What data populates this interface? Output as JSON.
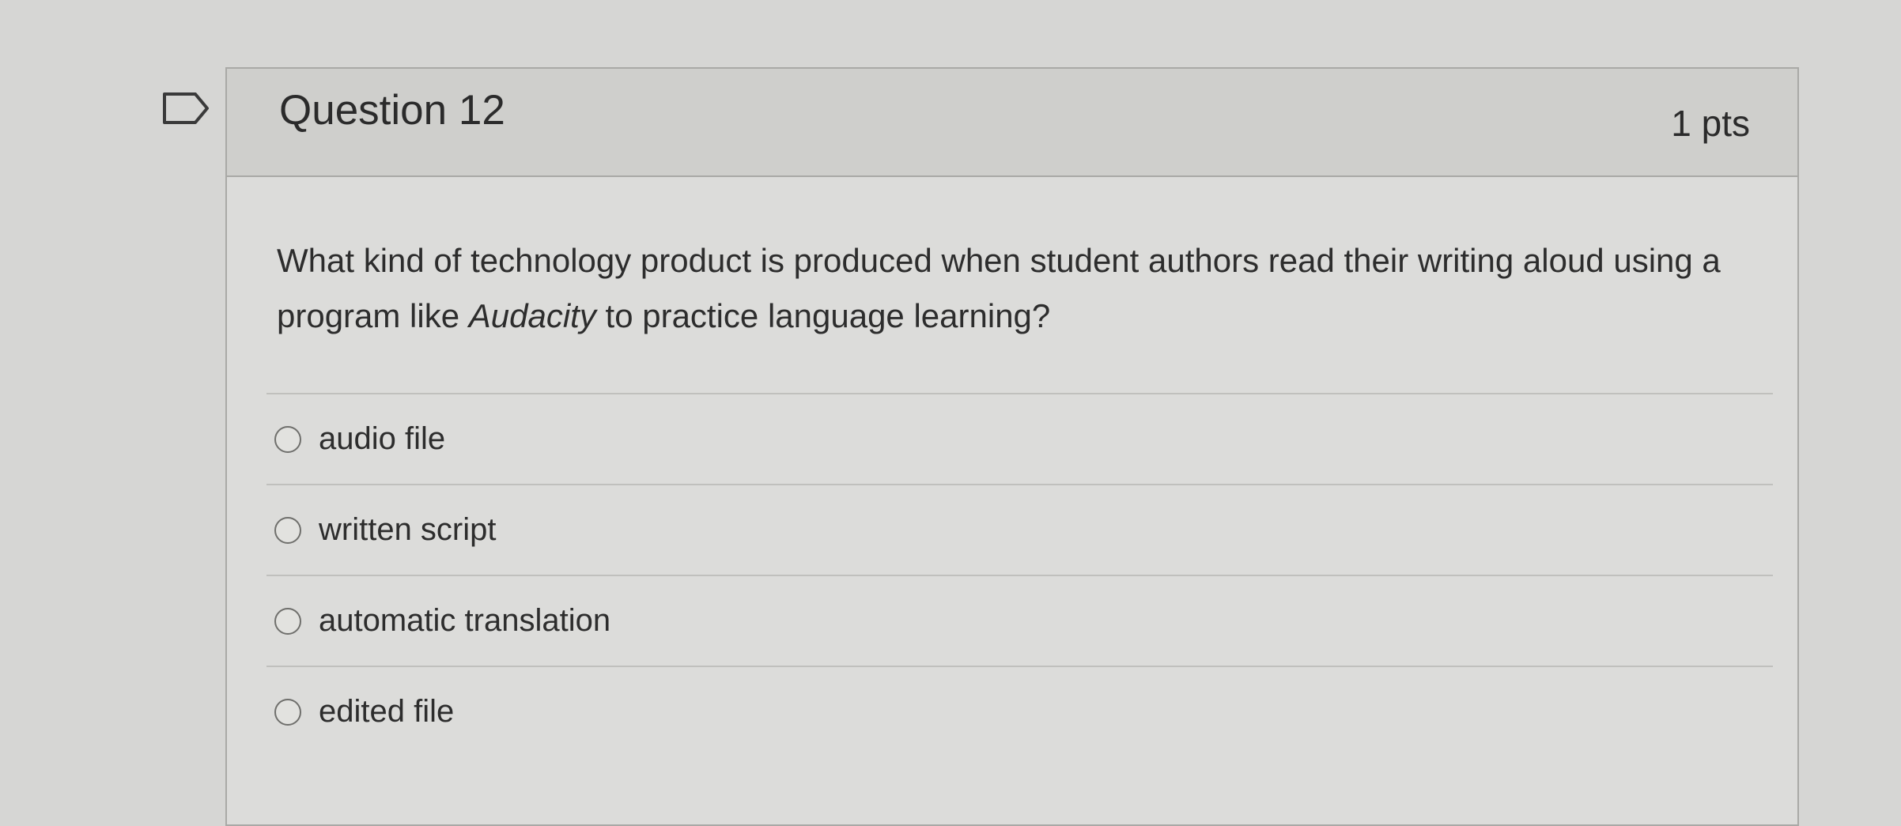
{
  "question": {
    "title": "Question 12",
    "points": "1 pts",
    "text_before": "What kind of technology product is produced when student authors read their writing aloud using a program like ",
    "text_italic": "Audacity",
    "text_after": " to practice language learning?",
    "flag_icon": "flag-outline-icon"
  },
  "answers": [
    {
      "label": "audio file"
    },
    {
      "label": "written script"
    },
    {
      "label": "automatic translation"
    },
    {
      "label": "edited file"
    }
  ],
  "colors": {
    "background": "#d6d6d4",
    "header": "#cfcfcc",
    "border": "#a9a9a6",
    "text": "#2d2d2d"
  }
}
